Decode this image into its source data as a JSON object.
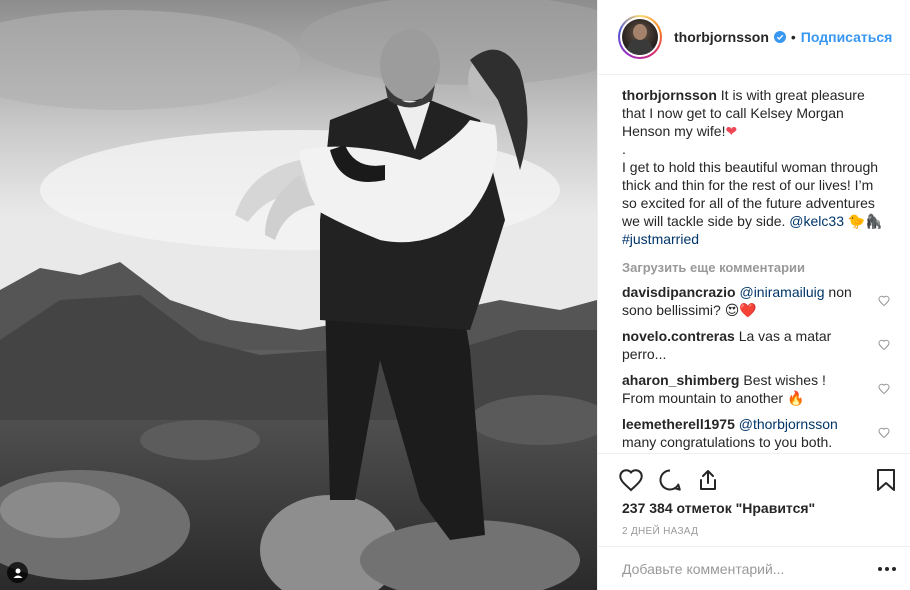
{
  "post": {
    "username": "thorbjornsson",
    "follow_label": "Подписаться",
    "dot": "•"
  },
  "caption": {
    "username": "thorbjornsson",
    "line1": "It is with great pleasure that I now get to call Kelsey Morgan Henson my wife!",
    "separator": ".",
    "line2": "I get to hold this beautiful woman through thick and thin for the rest of our lives! I’m so excited for all of the future adventures we will tackle side by side.",
    "mention": "@kelc33",
    "emojis": "🐤🦍",
    "hashtag": "#justmarried"
  },
  "load_more": "Загрузить еще комментарии",
  "comments": [
    {
      "user": "davisdipancrazio",
      "mention": "@iniramailuig",
      "text": "non sono bellissimi?",
      "emoji": "😍❤️"
    },
    {
      "user": "novelo.contreras",
      "mention": "",
      "text": "La vas a matar perro...",
      "emoji": ""
    },
    {
      "user": "aharon_shimberg",
      "mention": "",
      "text": "Best wishes ! From mountain to another",
      "emoji": "🔥"
    },
    {
      "user": "leemetherell1975",
      "mention": "@thorbjornsson",
      "text": "many congratulations to you both. Enjoy the lifetime of travelling",
      "emoji": ""
    }
  ],
  "likes_text": "237 384 отметок \"Нравится\"",
  "time_text": "2 дней назад",
  "add_comment_placeholder": "Добавьте комментарий...",
  "colors": {
    "accent": "#3897f0",
    "heart": "#ed4956",
    "muted": "#999999"
  },
  "icons": [
    "verified-icon",
    "heart-icon",
    "comment-icon",
    "share-icon",
    "bookmark-icon",
    "more-icon",
    "user-tag-icon"
  ]
}
